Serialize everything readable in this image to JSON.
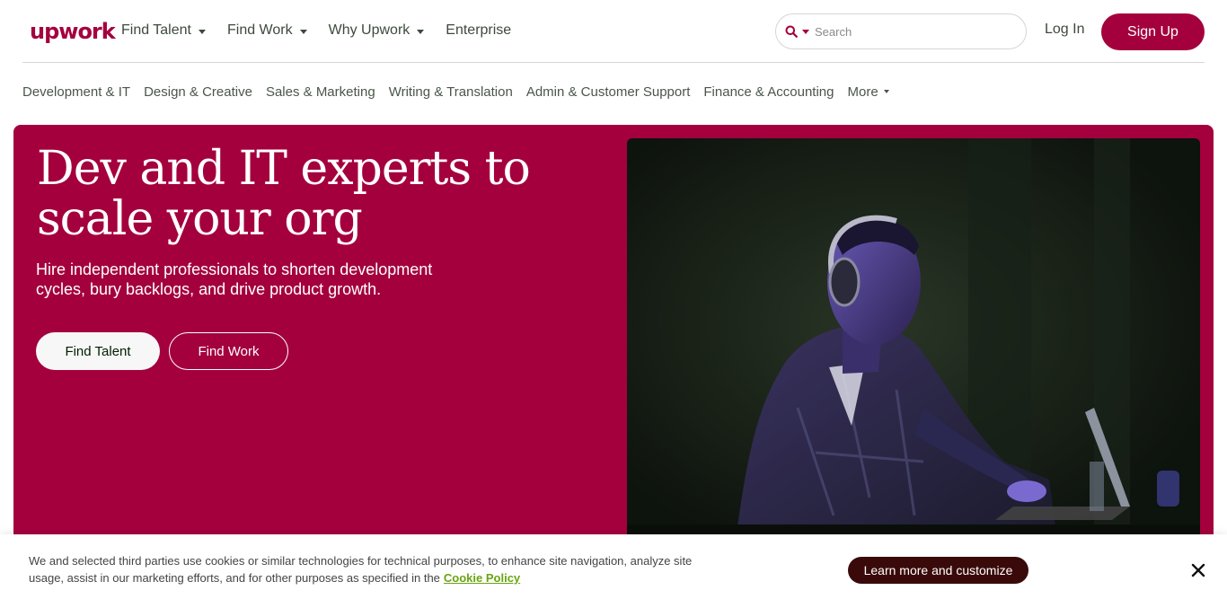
{
  "header": {
    "logo_text": "upwork",
    "nav": [
      {
        "label": "Find Talent",
        "dropdown": true
      },
      {
        "label": "Find Work",
        "dropdown": true
      },
      {
        "label": "Why Upwork",
        "dropdown": true
      },
      {
        "label": "Enterprise",
        "dropdown": false
      }
    ],
    "search": {
      "placeholder": "Search",
      "icon": "search-icon"
    },
    "login_label": "Log In",
    "signup_label": "Sign Up"
  },
  "categories": [
    "Development & IT",
    "Design & Creative",
    "Sales & Marketing",
    "Writing & Translation",
    "Admin & Customer Support",
    "Finance & Accounting",
    "More"
  ],
  "hero": {
    "title": "Dev and IT experts to scale your org",
    "subtitle": "Hire independent professionals to shorten development cycles, bury backlogs, and drive product growth.",
    "primary_cta": "Find Talent",
    "secondary_cta": "Find Work"
  },
  "cookie_banner": {
    "text": "We and selected third parties use cookies or similar technologies for technical purposes, to enhance site navigation, analyze site usage, assist in our marketing efforts, and for other purposes as specified in the",
    "link_label": "Cookie Policy",
    "customize_label": "Learn more and customize",
    "close_icon": "close-icon"
  },
  "colors": {
    "brand": "#a4003d",
    "link_green": "#6aa412",
    "banner_button": "#3a0a0a"
  }
}
